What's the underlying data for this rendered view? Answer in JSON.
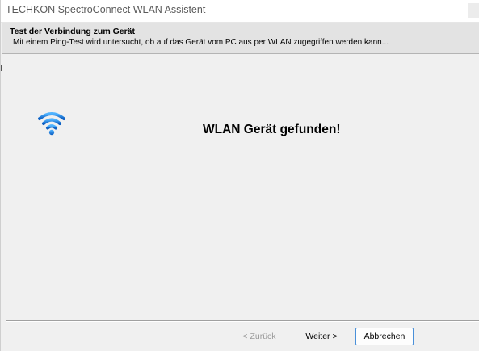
{
  "window": {
    "title": "TECHKON SpectroConnect WLAN Assistent"
  },
  "header": {
    "title": "Test der Verbindung zum Gerät",
    "subtitle": "Mit einem Ping-Test wird untersucht, ob auf das Gerät vom PC aus per WLAN zugegriffen werden kann..."
  },
  "content": {
    "icon": "wifi-icon",
    "message": "WLAN Gerät gefunden!"
  },
  "footer": {
    "back_label": "< Zurück",
    "next_label": "Weiter >",
    "cancel_label": "Abbrechen"
  },
  "colors": {
    "wifi_blue": "#1e88e5",
    "focus_border": "#4a90d9"
  }
}
